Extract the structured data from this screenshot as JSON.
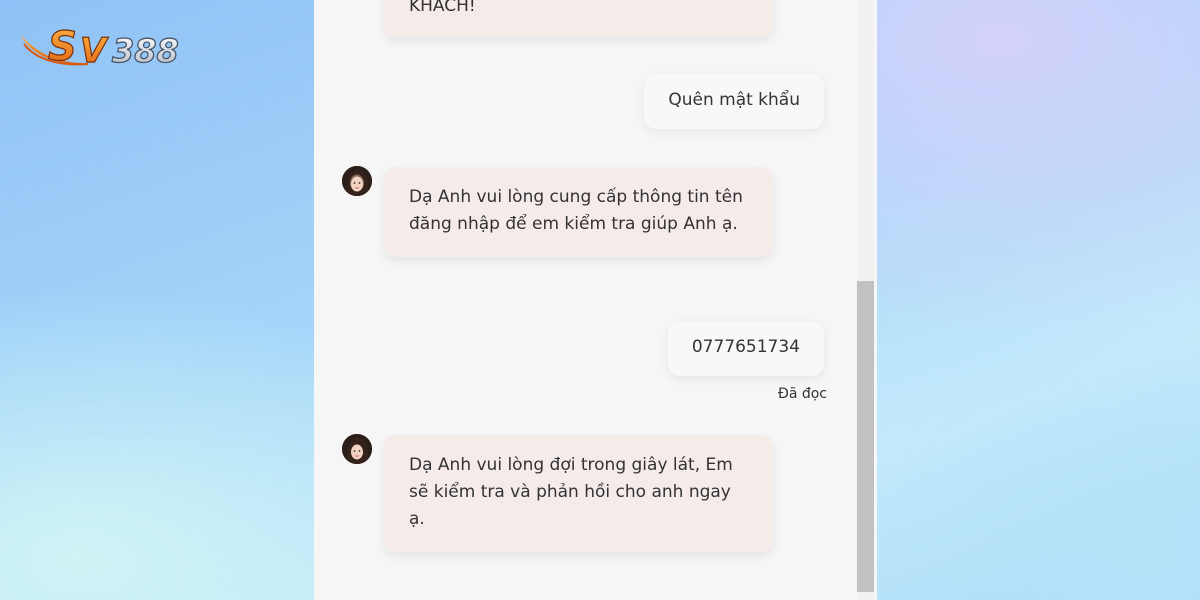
{
  "brand": {
    "logo_text": "SV388",
    "logo_colors": {
      "orange": "#f27a1a",
      "silver": "#cfd6e0"
    }
  },
  "chat": {
    "messages": [
      {
        "sender": "bot",
        "text": "KHÁCH!"
      },
      {
        "sender": "user",
        "text": "Quên mật khẩu"
      },
      {
        "sender": "bot",
        "text": "Dạ Anh vui lòng cung cấp thông tin tên đăng nhập để em kiểm tra giúp Anh ạ."
      },
      {
        "sender": "user",
        "text": "0777651734",
        "status": "Đã đọc"
      },
      {
        "sender": "bot",
        "text": "Dạ Anh vui lòng đợi trong giây lát, Em sẽ kiểm tra và phản hồi cho anh ngay ạ."
      }
    ]
  },
  "colors": {
    "bot_bubble": "#f5ebe9",
    "user_bubble": "#f8f8f8",
    "panel_bg": "#f6f6f6",
    "scroll_thumb": "#c1c1c1"
  }
}
